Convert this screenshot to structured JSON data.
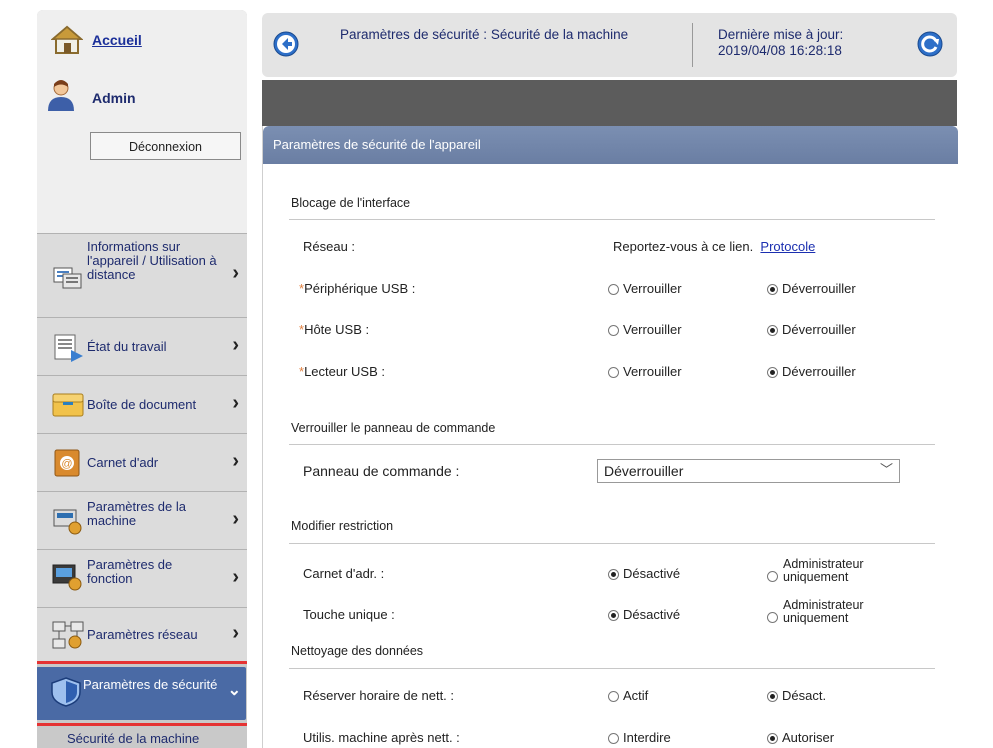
{
  "sidebar": {
    "home_label": "Accueil",
    "user_name": "Admin",
    "logout_label": "Déconnexion",
    "items": [
      {
        "label": "Informations sur l'appareil / Utilisation à distance",
        "icon": "device-info-icon"
      },
      {
        "label": "État du travail",
        "icon": "job-status-icon"
      },
      {
        "label": "Boîte de document",
        "icon": "document-box-icon"
      },
      {
        "label": "Carnet d'adr",
        "icon": "address-book-icon"
      },
      {
        "label": "Paramètres de la machine",
        "icon": "machine-settings-icon"
      },
      {
        "label": "Paramètres de fonction",
        "icon": "function-settings-icon"
      },
      {
        "label": "Paramètres réseau",
        "icon": "network-settings-icon"
      }
    ],
    "active_item": {
      "label": "Paramètres de sécurité",
      "icon": "security-shield-icon"
    },
    "sub_item": "Sécurité de la machine"
  },
  "header": {
    "title": "Paramètres de sécurité : Sécurité de la machine",
    "last_update_label": "Dernière mise à jour:",
    "last_update_value": "2019/04/08 16:28:18"
  },
  "panel": {
    "title": "Paramètres de sécurité de l'appareil",
    "interface_block": {
      "title": "Blocage de l'interface",
      "network_label": "Réseau :",
      "network_text": "Reportez-vous à ce lien.",
      "network_link": "Protocole",
      "rows": [
        {
          "label": "Périphérique USB :",
          "opt1": "Verrouiller",
          "opt2": "Déverrouiller",
          "selected": 2
        },
        {
          "label": "Hôte USB :",
          "opt1": "Verrouiller",
          "opt2": "Déverrouiller",
          "selected": 2
        },
        {
          "label": "Lecteur USB :",
          "opt1": "Verrouiller",
          "opt2": "Déverrouiller",
          "selected": 2
        }
      ]
    },
    "lock_panel": {
      "title": "Verrouiller le panneau de commande",
      "label": "Panneau de commande :",
      "value": "Déverrouiller"
    },
    "restriction": {
      "title": "Modifier restriction",
      "rows": [
        {
          "label": "Carnet d'adr. :",
          "opt1": "Désactivé",
          "opt2_line1": "Administrateur",
          "opt2_line2": "uniquement",
          "selected": 1
        },
        {
          "label": "Touche unique :",
          "opt1": "Désactivé",
          "opt2_line1": "Administrateur",
          "opt2_line2": "uniquement",
          "selected": 1
        }
      ]
    },
    "cleaning": {
      "title": "Nettoyage des données",
      "rows": [
        {
          "label": "Réserver horaire de nett. :",
          "opt1": "Actif",
          "opt2": "Désact.",
          "selected": 2
        },
        {
          "label": "Utilis. machine après nett. :",
          "opt1": "Interdire",
          "opt2": "Autoriser",
          "selected": 2
        }
      ]
    }
  },
  "colors": {
    "sidebar_bg": "#c9c9c9",
    "active_item_bg": "#4a6aa5",
    "highlight_border": "#e53333",
    "panel_header": "#6f83a8",
    "link": "#1b2fb0"
  }
}
